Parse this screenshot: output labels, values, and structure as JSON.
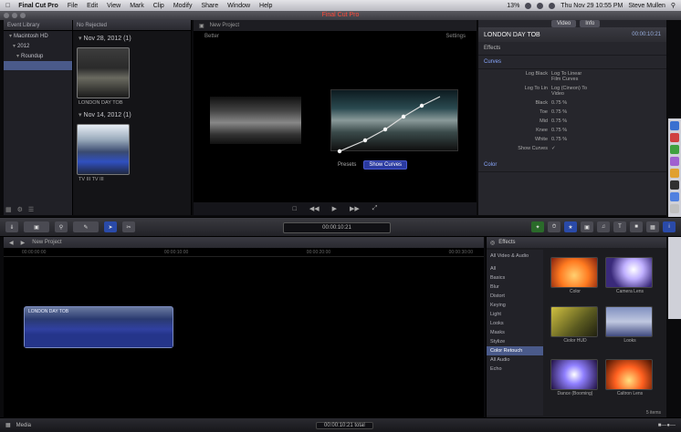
{
  "menubar": {
    "apple": "",
    "app": "Final Cut Pro",
    "items": [
      "File",
      "Edit",
      "View",
      "Mark",
      "Clip",
      "Modify",
      "Share",
      "Window",
      "Help"
    ],
    "status": "13%",
    "clock": "Thu Nov 29  10:55 PM",
    "user": "Steve Mullen"
  },
  "window": {
    "title": "Final Cut Pro"
  },
  "library": {
    "header": "Event Library",
    "items": [
      {
        "label": "Macintosh HD",
        "selected": false
      },
      {
        "label": "2012",
        "selected": false
      },
      {
        "label": "Roundup",
        "selected": false
      },
      {
        "label": "",
        "selected": true
      }
    ]
  },
  "events": {
    "header": "No Rejected",
    "groups": [
      {
        "date": "Nov 28, 2012  (1)",
        "clip": "LONDON DAY TOB"
      },
      {
        "date": "Nov 14, 2012  (1)",
        "clip": "TV III  TV III"
      }
    ]
  },
  "viewer": {
    "title": "New Project",
    "sub_left": "Better",
    "sub_right": "Settings",
    "overlay_label": "Presets",
    "show_curves": "Show Curves"
  },
  "inspector": {
    "tabs": [
      "Video",
      "Info"
    ],
    "title": "LONDON DAY TOB",
    "timecode": "00:00:10:21",
    "sections": [
      "Effects",
      "Curves"
    ],
    "rows": [
      {
        "label": "Log Black",
        "value": "Log To Linear Film Curves"
      },
      {
        "label": "Log To Lin",
        "value": "Log (Cineon) To Video"
      },
      {
        "label": "Black",
        "value": "0.75 %"
      },
      {
        "label": "Toe",
        "value": "0.75 %"
      },
      {
        "label": "Mid",
        "value": "0.75 %"
      },
      {
        "label": "Knee",
        "value": "0.75 %"
      },
      {
        "label": "White",
        "value": "0.75 %"
      }
    ],
    "show_curves": "Show Curves",
    "color": "Color"
  },
  "toolbar": {
    "center": "00:00:10:21",
    "buttons": [
      "Import",
      "Camera",
      "Key",
      "Tools",
      "Blade",
      "Trim",
      "Share"
    ]
  },
  "timeline": {
    "title": "New Project",
    "ruler": [
      "00:00:00:00",
      "00:00:10:00",
      "00:00:20:00",
      "00:00:30:00"
    ],
    "clip": "LONDON DAY TOB"
  },
  "effects": {
    "header": "Effects",
    "categories": [
      "All Video & Audio",
      "",
      "All",
      "Basics",
      "Blur",
      "Distort",
      "Keying",
      "Light",
      "Looks",
      "Masks",
      "Stylize",
      "Color Retouch",
      "All Audio",
      "Echo"
    ],
    "selected_index": 11,
    "items": [
      "Color",
      "Camera Lens",
      "Ciolor HUD",
      "Looks",
      "Dance (Booming)",
      "Caltron Lens"
    ],
    "count": "5 items"
  },
  "status": {
    "left": "Media",
    "center": "00:00:10:21 total"
  }
}
